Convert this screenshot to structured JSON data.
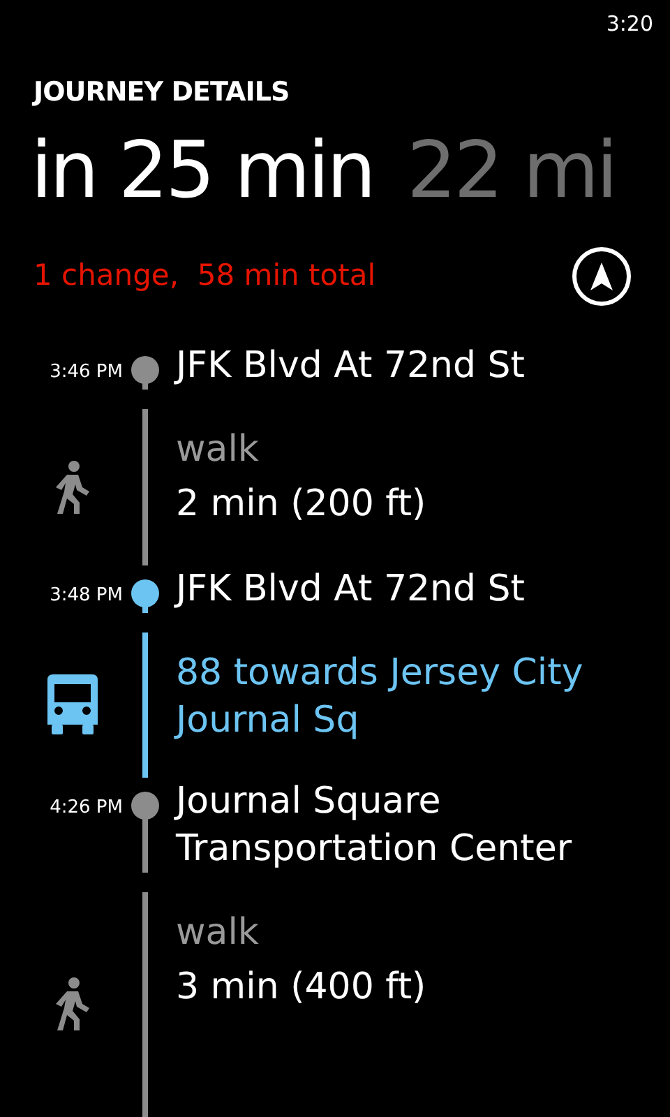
{
  "status_bar": {
    "time": "3:20"
  },
  "page_title": "JOURNEY DETAILS",
  "pivot": [
    {
      "label": "in 25 min",
      "selected": true
    },
    {
      "label": "22 mi",
      "selected": false
    }
  ],
  "summary": "1 change,  58 min total",
  "timeline": [
    {
      "kind": "stop",
      "time": "3:46 PM",
      "name": "JFK Blvd At 72nd St",
      "color": "#8c8c8c"
    },
    {
      "kind": "walk",
      "mode": "walk",
      "detail": "2 min (200 ft)",
      "color": "#8c8c8c"
    },
    {
      "kind": "stop",
      "time": "3:48 PM",
      "name": "JFK Blvd At 72nd St",
      "color": "#6cc4f2"
    },
    {
      "kind": "bus",
      "route": "88 towards Jersey City Journal Sq",
      "color": "#6cc4f2"
    },
    {
      "kind": "stop",
      "time": "4:26 PM",
      "name": "Journal Square Transportation Center",
      "color": "#8c8c8c"
    },
    {
      "kind": "walk",
      "mode": "walk",
      "detail": "3 min (400 ft)",
      "color": "#8c8c8c"
    }
  ]
}
